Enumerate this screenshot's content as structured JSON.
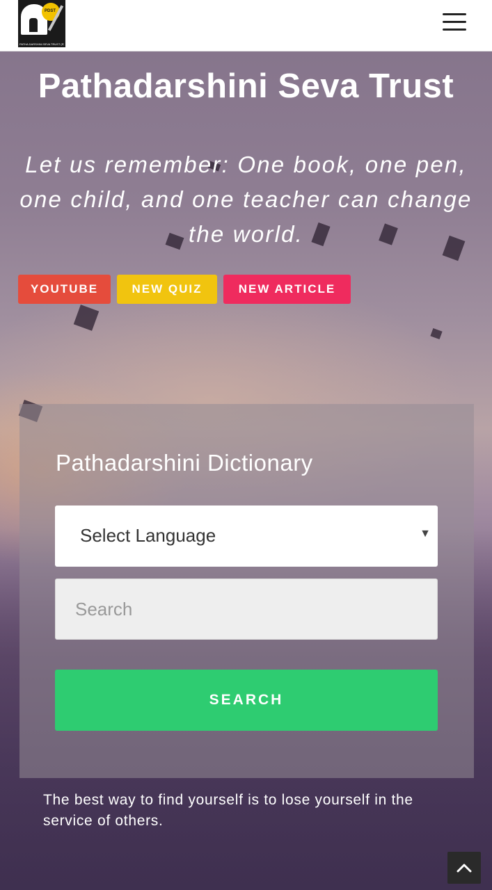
{
  "header": {
    "logo_alt": "Patha Darshini Seva Trust logo",
    "logo_caption": "PATHA DARSHINI SEVA TRUST (R)",
    "logo_mark": "PDST",
    "menu_icon": "hamburger-menu-icon"
  },
  "hero": {
    "title": "Pathadarshini Seva Trust",
    "quote": "Let us remember: One book, one pen, one child, and one teacher can change the world."
  },
  "tags": [
    {
      "label": "YOUTUBE",
      "color": "#e54c3c"
    },
    {
      "label": "NEW QUIZ",
      "color": "#f1c40f"
    },
    {
      "label": "NEW ARTICLE",
      "color": "#ef2b5e"
    }
  ],
  "dictionary": {
    "title": "Pathadarshini Dictionary",
    "language_select": "Select Language",
    "search_placeholder": "Search",
    "search_button": "SEARCH",
    "button_color": "#2ecc71"
  },
  "tagline": "The best way to find yourself is to lose yourself in the service of others.",
  "scroll_top_icon": "chevron-up-icon"
}
